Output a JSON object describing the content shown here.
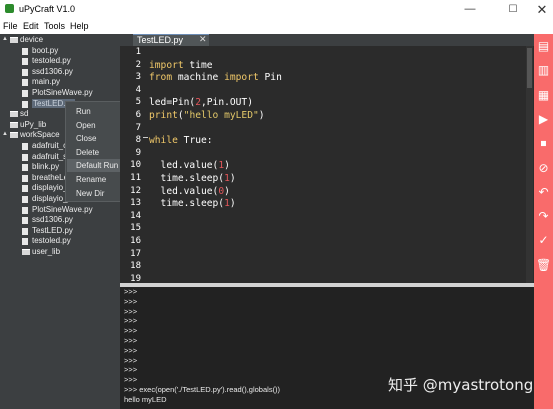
{
  "window": {
    "title": "uPyCraft V1.0",
    "min": "—",
    "max": "☐",
    "close": "✕"
  },
  "menu": [
    "File",
    "Edit",
    "Tools",
    "Help"
  ],
  "tree": [
    {
      "label": "device",
      "type": "folder",
      "arrow": "▲"
    },
    {
      "label": "boot.py",
      "type": "file"
    },
    {
      "label": "testoled.py",
      "type": "file"
    },
    {
      "label": "ssd1306.py",
      "type": "file"
    },
    {
      "label": "main.py",
      "type": "file"
    },
    {
      "label": "PlotSineWave.py",
      "type": "file"
    },
    {
      "label": "TestLED.py",
      "type": "file",
      "selected": true
    },
    {
      "label": "sd",
      "type": "folder"
    },
    {
      "label": "uPy_lib",
      "type": "folder"
    },
    {
      "label": "workSpace",
      "type": "folder",
      "arrow": "▲"
    },
    {
      "label": "adafruit_c",
      "type": "file"
    },
    {
      "label": "adafruit_s",
      "type": "file"
    },
    {
      "label": "blink.py",
      "type": "file"
    },
    {
      "label": "breatheLe",
      "type": "file"
    },
    {
      "label": "displayio_",
      "type": "file"
    },
    {
      "label": "displayio_",
      "type": "file"
    },
    {
      "label": "PlotSineWave.py",
      "type": "file"
    },
    {
      "label": "ssd1306.py",
      "type": "file"
    },
    {
      "label": "TestLED.py",
      "type": "file"
    },
    {
      "label": "testoled.py",
      "type": "file"
    },
    {
      "label": "user_lib",
      "type": "folder"
    }
  ],
  "context_menu": [
    {
      "label": "Run"
    },
    {
      "label": "Open"
    },
    {
      "label": "Close"
    },
    {
      "label": "Delete"
    },
    {
      "label": "Default Run",
      "highlighted": true
    },
    {
      "label": "Rename"
    },
    {
      "label": "New Dir"
    }
  ],
  "tab": {
    "label": "TestLED.py",
    "close": "✕"
  },
  "line_numbers": [
    "1",
    "2",
    "3",
    "4",
    "5",
    "6",
    "7",
    "8",
    "9",
    "10",
    "11",
    "12",
    "13",
    "14",
    "15",
    "16",
    "17",
    "18",
    "19"
  ],
  "code": [
    [],
    [
      {
        "t": "import",
        "c": "kw"
      },
      {
        "t": " time"
      }
    ],
    [
      {
        "t": "from",
        "c": "kw"
      },
      {
        "t": " machine "
      },
      {
        "t": "import",
        "c": "kw"
      },
      {
        "t": " Pin"
      }
    ],
    [],
    [
      {
        "t": "led=Pin("
      },
      {
        "t": "2",
        "c": "num"
      },
      {
        "t": ",Pin.OUT)"
      }
    ],
    [
      {
        "t": "print",
        "c": "kw"
      },
      {
        "t": "("
      },
      {
        "t": "\"hello myLED\"",
        "c": "str"
      },
      {
        "t": ")"
      }
    ],
    [],
    [
      {
        "t": "while",
        "c": "kw"
      },
      {
        "t": " True:"
      }
    ],
    [],
    [
      {
        "t": "  led.value("
      },
      {
        "t": "1",
        "c": "num"
      },
      {
        "t": ")"
      }
    ],
    [
      {
        "t": "  time.sleep("
      },
      {
        "t": "1",
        "c": "num"
      },
      {
        "t": ")"
      }
    ],
    [
      {
        "t": "  led.value("
      },
      {
        "t": "0",
        "c": "num"
      },
      {
        "t": ")"
      }
    ],
    [
      {
        "t": "  time.sleep("
      },
      {
        "t": "1",
        "c": "num"
      },
      {
        "t": ")"
      }
    ],
    [],
    [],
    [],
    [],
    [],
    []
  ],
  "terminal": [
    ">>>",
    ">>>",
    ">>>",
    ">>>",
    ">>>",
    ">>>",
    ">>>",
    ">>>",
    ">>>",
    ">>>",
    ">>> exec(open('./TestLED.py').read(),globals())",
    "hello myLED"
  ],
  "toolbar_icons": [
    "new-file-icon",
    "open-file-icon",
    "save-icon",
    "download-run-icon",
    "stop-icon",
    "connect-icon",
    "undo-icon",
    "redo-icon",
    "syntax-check-icon",
    "clear-icon"
  ],
  "watermark": "知乎 @myastrotong",
  "colors": {
    "sidebar": "#3c3f41",
    "editor": "#2b2b2b",
    "toolbar": "#f96b6b",
    "keyword": "#f0c869",
    "number": "#e3565a"
  }
}
